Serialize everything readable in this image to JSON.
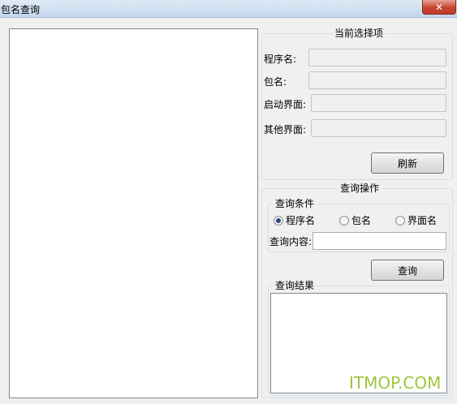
{
  "window": {
    "title": "包名查询",
    "close_icon": "✕"
  },
  "current_selection": {
    "title": "当前选择项",
    "fields": [
      {
        "label": "程序名:",
        "value": ""
      },
      {
        "label": "包名:",
        "value": ""
      },
      {
        "label": "启动界面:",
        "value": ""
      },
      {
        "label": "其他界面:",
        "value": ""
      }
    ],
    "refresh_label": "刷新"
  },
  "query": {
    "title": "查询操作",
    "condition_title": "查询条件",
    "options": [
      {
        "label": "程序名",
        "selected": true
      },
      {
        "label": "包名",
        "selected": false
      },
      {
        "label": "界面名",
        "selected": false
      }
    ],
    "content_label": "查询内容:",
    "content_value": "",
    "query_label": "查询",
    "result_title": "查询结果"
  },
  "watermark": "ITMOP.COM"
}
